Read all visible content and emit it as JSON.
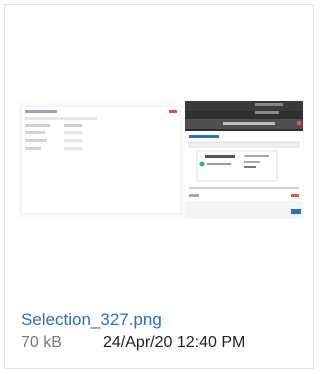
{
  "attachment": {
    "filename": "Selection_327.png",
    "size": "70 kB",
    "date": "24/Apr/20 12:40 PM"
  },
  "thumbnail": {
    "icon": "image-thumbnail-icon"
  }
}
